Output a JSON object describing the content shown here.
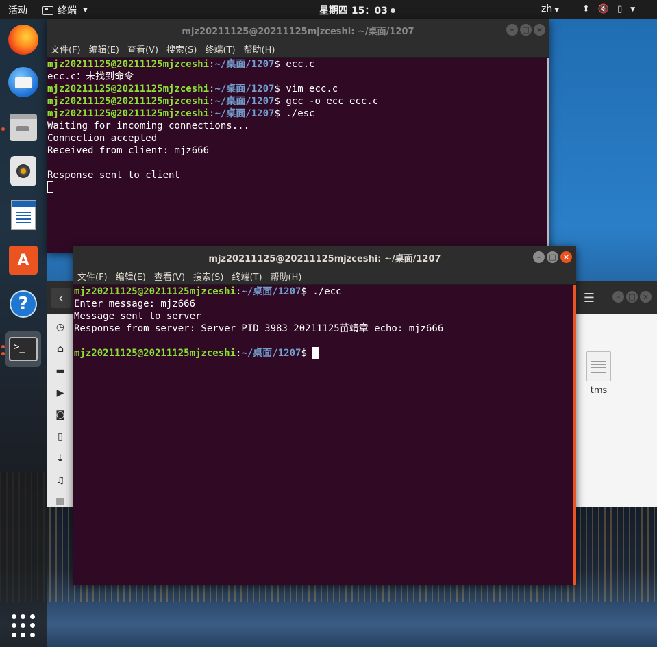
{
  "topbar": {
    "activities": "活动",
    "app_name": "终端",
    "clock": "星期四 15：03",
    "lang": "zh"
  },
  "dock": {
    "items": [
      "firefox-icon",
      "thunderbird-icon",
      "files-icon",
      "rhythmbox-icon",
      "libreoffice-writer-icon",
      "software-center-icon",
      "help-icon",
      "terminal-icon",
      "show-apps-icon"
    ]
  },
  "file_manager": {
    "file_name": "tms"
  },
  "terminal_back": {
    "title": "mjz20211125@20211125mjzceshi: ~/桌面/1207",
    "menu": [
      "文件(F)",
      "编辑(E)",
      "查看(V)",
      "搜索(S)",
      "终端(T)",
      "帮助(H)"
    ],
    "user_host": "mjz20211125@20211125mjzceshi",
    "path": "~/桌面/1207",
    "lines": [
      {
        "prompt": true,
        "cmd": " ecc.c"
      },
      {
        "prompt": false,
        "text": "ecc.c：未找到命令"
      },
      {
        "prompt": true,
        "cmd": " vim ecc.c"
      },
      {
        "prompt": true,
        "cmd": " gcc -o ecc ecc.c"
      },
      {
        "prompt": true,
        "cmd": " ./esc"
      },
      {
        "prompt": false,
        "text": "Waiting for incoming connections..."
      },
      {
        "prompt": false,
        "text": "Connection accepted"
      },
      {
        "prompt": false,
        "text": "Received from client: mjz666"
      },
      {
        "prompt": false,
        "text": ""
      },
      {
        "prompt": false,
        "text": "Response sent to client"
      }
    ]
  },
  "terminal_front": {
    "title": "mjz20211125@20211125mjzceshi: ~/桌面/1207",
    "menu": [
      "文件(F)",
      "编辑(E)",
      "查看(V)",
      "搜索(S)",
      "终端(T)",
      "帮助(H)"
    ],
    "user_host": "mjz20211125@20211125mjzceshi",
    "path": "~/桌面/1207",
    "lines": [
      {
        "prompt": true,
        "cmd": " ./ecc"
      },
      {
        "prompt": false,
        "text": "Enter message: mjz666"
      },
      {
        "prompt": false,
        "text": "Message sent to server"
      },
      {
        "prompt": false,
        "text": "Response from server: Server PID 3983 20211125苗靖章 echo: mjz666"
      },
      {
        "prompt": false,
        "text": ""
      },
      {
        "prompt": true,
        "cmd": " "
      }
    ]
  }
}
